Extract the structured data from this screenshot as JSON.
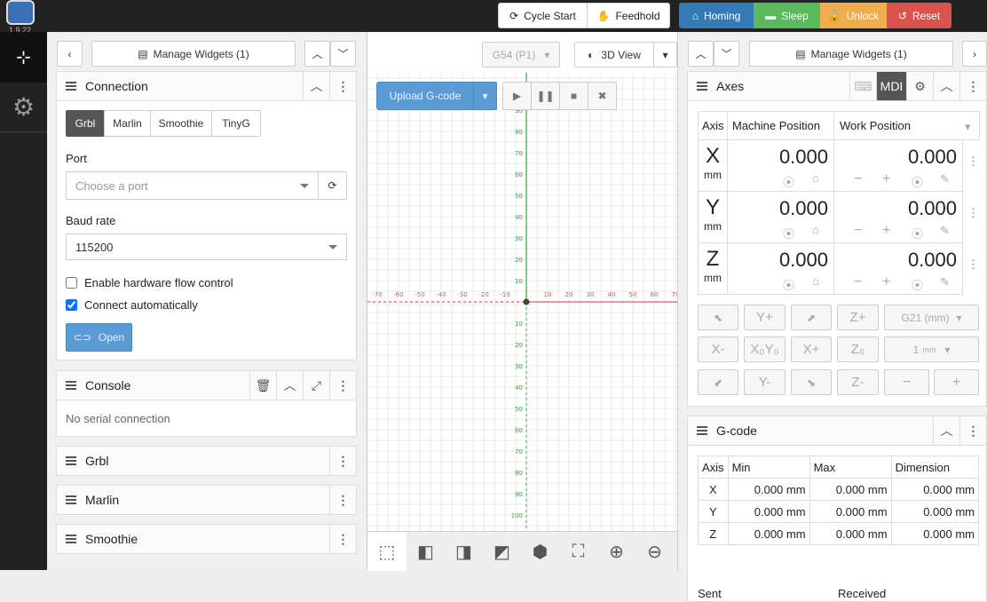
{
  "app": {
    "version": "1.9.22"
  },
  "toolbar": {
    "cycle_start": "Cycle Start",
    "feedhold": "Feedhold",
    "homing": "Homing",
    "sleep": "Sleep",
    "unlock": "Unlock",
    "reset": "Reset"
  },
  "colors": {
    "homing": "#337ab7",
    "sleep": "#5cb85c",
    "unlock": "#f0ad4e",
    "reset": "#d9534f",
    "open": "#5b9bd5"
  },
  "left": {
    "manage": "Manage Widgets (1)",
    "connection": {
      "title": "Connection",
      "tabs": [
        "Grbl",
        "Marlin",
        "Smoothie",
        "TinyG"
      ],
      "port_label": "Port",
      "port_placeholder": "Choose a port",
      "baud_label": "Baud rate",
      "baud_value": "115200",
      "flow": "Enable hardware flow control",
      "auto": "Connect automatically",
      "open": "Open"
    },
    "console": {
      "title": "Console",
      "msg": "No serial connection"
    },
    "widgets": [
      "Grbl",
      "Marlin",
      "Smoothie"
    ]
  },
  "center": {
    "wcs": "G54 (P1)",
    "view": "3D View",
    "upload": "Upload G-code",
    "xticks": [
      "-70",
      "-60",
      "-50",
      "-40",
      "-30",
      "-20",
      "-10",
      "10",
      "20",
      "30",
      "40",
      "50",
      "60",
      "70"
    ],
    "yticks_pos": [
      "90",
      "80",
      "70",
      "60",
      "50",
      "40",
      "30",
      "20",
      "10"
    ],
    "yticks_neg": [
      "10",
      "20",
      "30",
      "40",
      "50",
      "60",
      "70",
      "80",
      "90",
      "100"
    ]
  },
  "right": {
    "manage": "Manage Widgets (1)",
    "axes": {
      "title": "Axes",
      "mdi": "MDI",
      "col_axis": "Axis",
      "col_machine": "Machine Position",
      "col_work": "Work Position",
      "rows": [
        {
          "axis": "X",
          "unit": "mm",
          "machine": "0.000",
          "work": "0.000"
        },
        {
          "axis": "Y",
          "unit": "mm",
          "machine": "0.000",
          "work": "0.000"
        },
        {
          "axis": "Z",
          "unit": "mm",
          "machine": "0.000",
          "work": "0.000"
        }
      ],
      "jog": {
        "yplus": "Y+",
        "zplus": "Z+",
        "units": "G21 (mm)",
        "xminus": "X-",
        "x0y0": "X₀Y₀",
        "xplus": "X+",
        "z0": "Z₀",
        "step": "1",
        "step_unit": "mm",
        "yminus": "Y-",
        "zminus": "Z-"
      }
    },
    "gcode": {
      "title": "G-code",
      "cols": [
        "Axis",
        "Min",
        "Max",
        "Dimension"
      ],
      "rows": [
        [
          "X",
          "0.000 mm",
          "0.000 mm",
          "0.000 mm"
        ],
        [
          "Y",
          "0.000 mm",
          "0.000 mm",
          "0.000 mm"
        ],
        [
          "Z",
          "0.000 mm",
          "0.000 mm",
          "0.000 mm"
        ]
      ],
      "sent": "Sent",
      "received": "Received"
    }
  }
}
